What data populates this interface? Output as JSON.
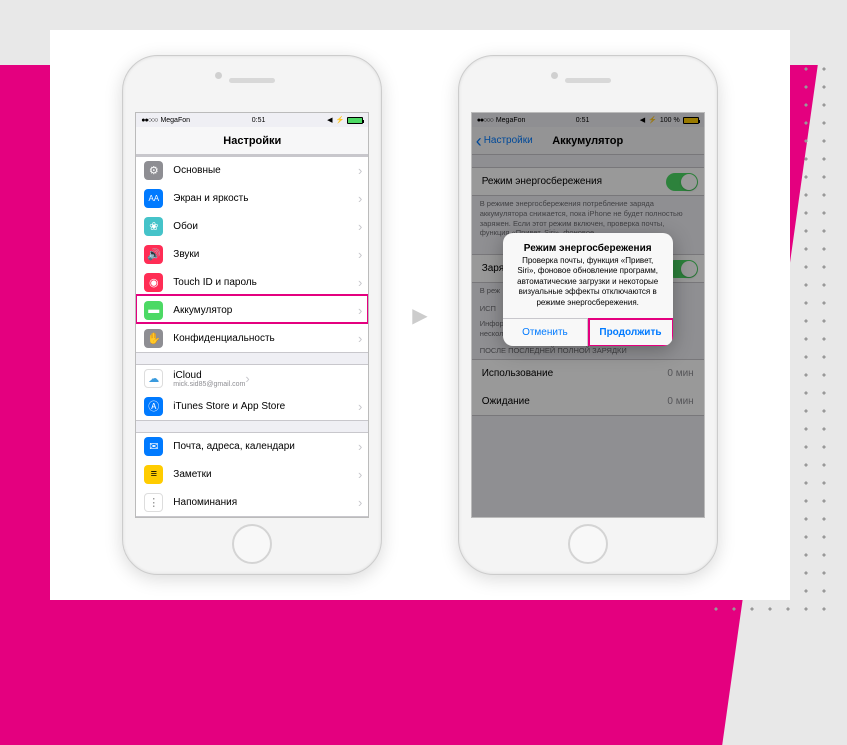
{
  "status": {
    "carrier": "MegaFon",
    "time": "0:51",
    "battery_pct_right": "100 %"
  },
  "left": {
    "nav_title": "Настройки",
    "rows": {
      "general": "Основные",
      "display": "Экран и яркость",
      "wallpaper": "Обои",
      "sounds": "Звуки",
      "touchid": "Touch ID и пароль",
      "battery": "Аккумулятор",
      "privacy": "Конфиденциальность",
      "icloud": "iCloud",
      "icloud_sub": "mick.sid85@gmail.com",
      "itunes": "iTunes Store и App Store",
      "mail": "Почта, адреса, календари",
      "notes": "Заметки",
      "reminders": "Напоминания"
    }
  },
  "right": {
    "nav_back": "Настройки",
    "nav_title": "Аккумулятор",
    "low_power": "Режим энергосбережения",
    "low_power_note": "В режиме энергосбережения потребление заряда аккумулятора снижается, пока iPhone не будет полностью заряжен. Если этот режим включен, проверка почты, функция «Привет, Siri», фоновое",
    "charge_row": "Заря",
    "charge_note": "В реж",
    "usage_header": "ИСП",
    "usage_note": "Информация об аккумуляторе будет доступна через несколько минут после начала использования iPhone.",
    "last_charge_header": "ПОСЛЕ ПОСЛЕДНЕЙ ПОЛНОЙ ЗАРЯДКИ",
    "usage_row": "Использование",
    "usage_val": "0 мин",
    "standby_row": "Ожидание",
    "standby_val": "0 мин"
  },
  "alert": {
    "title": "Режим энергосбережения",
    "message": "Проверка почты, функция «Привет, Siri», фоновое обновление программ, автоматические загрузки и некоторые визуальные эффекты отключаются в режиме энергосбережения.",
    "cancel": "Отменить",
    "continue": "Продолжить"
  },
  "icons": {
    "general_bg": "#8e8e93",
    "display_bg": "#007aff",
    "wallpaper_bg": "#45c3c9",
    "sounds_bg": "#ff2d55",
    "touchid_bg": "#ff2d55",
    "battery_bg": "#4cd964",
    "privacy_bg": "#8e8e93",
    "icloud_bg": "#ffffff",
    "itunes_bg": "#007aff",
    "mail_bg": "#007aff",
    "notes_bg": "#ffcc00",
    "reminders_bg": "#ffffff"
  }
}
